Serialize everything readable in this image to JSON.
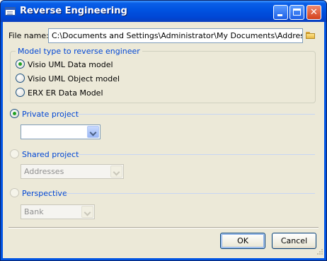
{
  "window": {
    "title": "Reverse Engineering",
    "minimize_label": "",
    "maximize_label": "",
    "close_label": "✕"
  },
  "file": {
    "label": "File name:",
    "value": "C:\\Documents and Settings\\Administrator\\My Documents\\Addresses.vsd"
  },
  "model_group": {
    "title": "Model type to reverse engineer",
    "options": [
      {
        "label": "Visio UML Data model",
        "checked": true
      },
      {
        "label": "Visio UML Object model",
        "checked": false
      },
      {
        "label": "ERX ER Data Model",
        "checked": false
      }
    ]
  },
  "private_project": {
    "label": "Private project",
    "checked": true,
    "value": ""
  },
  "shared_project": {
    "label": "Shared project",
    "checked": false,
    "value": "Addresses"
  },
  "perspective": {
    "label": "Perspective",
    "checked": false,
    "value": "Bank"
  },
  "buttons": {
    "ok": "OK",
    "cancel": "Cancel"
  }
}
